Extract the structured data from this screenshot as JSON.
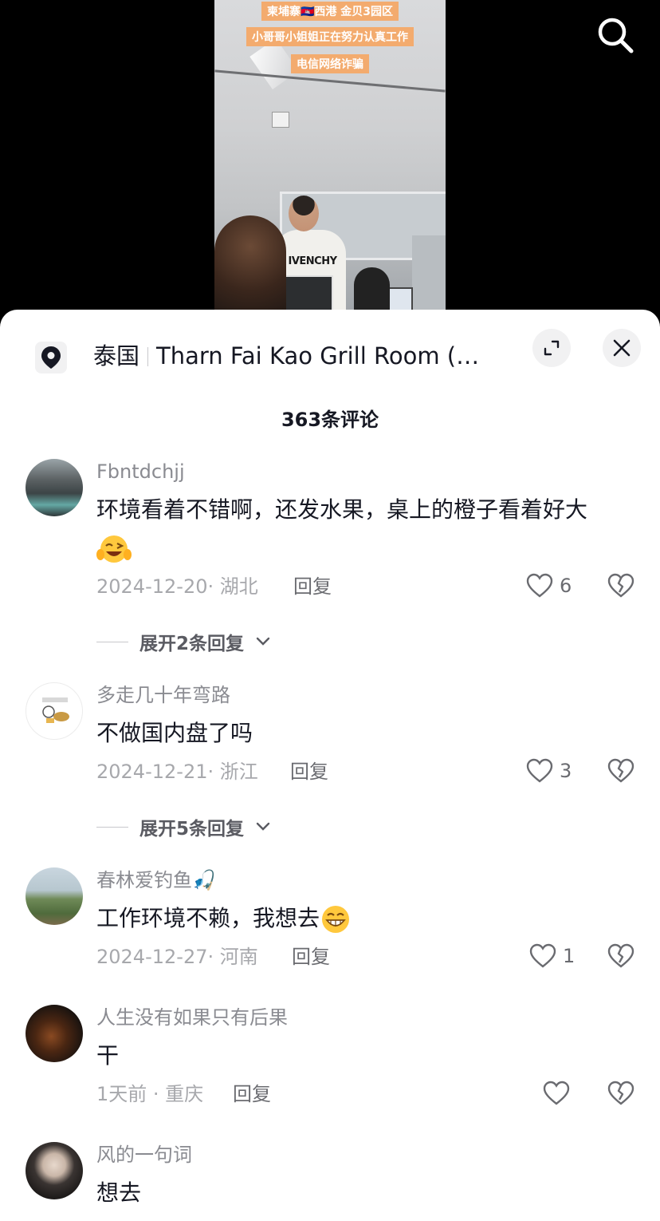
{
  "video": {
    "captions": [
      "柬埔寨🇰🇭西港 金贝3园区",
      "小哥哥小姐姐正在努力认真工作",
      "电信网络诈骗"
    ],
    "shirt_text": "IVENCHY"
  },
  "location": {
    "country": "泰国",
    "place": "Tharn Fai Kao Grill Room (ถ่..."
  },
  "comment_count_label": "363条评论",
  "comments": [
    {
      "username": "Fbntdchjj",
      "text": "环境看着不错啊，还发水果，桌上的橙子看着好大",
      "date": "2024-12-20",
      "region": "湖北",
      "reply_label": "回复",
      "likes": "6",
      "expand_label": "展开2条回复",
      "avatar": "mountain-lake-photo"
    },
    {
      "username": "多走几十年弯路",
      "text": "不做国内盘了吗",
      "date": "2024-12-21",
      "region": "浙江",
      "reply_label": "回复",
      "likes": "3",
      "expand_label": "展开5条回复",
      "avatar": "sticker-illustration"
    },
    {
      "username": "春林爱钓鱼🎣",
      "text": "工作环境不赖，我想去",
      "date": "2024-12-27",
      "region": "河南",
      "reply_label": "回复",
      "likes": "1",
      "avatar": "person-outdoor-photo"
    },
    {
      "username": "人生没有如果只有后果",
      "text": "干",
      "date": "1天前",
      "region": "重庆",
      "reply_label": "回复",
      "likes": "",
      "avatar": "dark-silhouette-photo"
    },
    {
      "username": "风的一句词",
      "text": "想去",
      "avatar": "portrait-photo"
    }
  ],
  "colors": {
    "caption_bg": "#f3ab6e",
    "text_primary": "#161823",
    "text_secondary": "#8a8b91"
  }
}
